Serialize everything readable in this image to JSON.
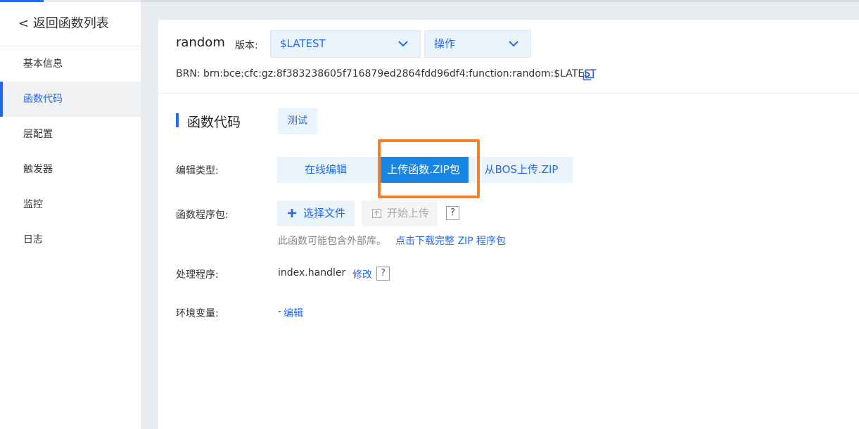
{
  "sidebar": {
    "back_label": "< 返回函数列表",
    "items": [
      {
        "label": "基本信息",
        "active": false
      },
      {
        "label": "函数代码",
        "active": true
      },
      {
        "label": "层配置",
        "active": false
      },
      {
        "label": "触发器",
        "active": false
      },
      {
        "label": "监控",
        "active": false
      },
      {
        "label": "日志",
        "active": false
      }
    ]
  },
  "header": {
    "function_name": "random",
    "version_label": "版本:",
    "version_value": "$LATEST",
    "operations_label": "操作",
    "brn": "BRN:  brn:bce:cfc:gz:8f383238605f716879ed2864fdd96df4:function:random:$LATEST"
  },
  "code_section": {
    "title": "函数代码",
    "test_button": "测试",
    "edit_type_label": "编辑类型:",
    "tabs": [
      {
        "label": "在线编辑",
        "active": false
      },
      {
        "label": "上传函数.ZIP包",
        "active": true
      },
      {
        "label": "从BOS上传.ZIP",
        "active": false
      }
    ],
    "package_label": "函数程序包:",
    "choose_file": "选择文件",
    "start_upload": "开始上传",
    "help": "?",
    "hint": "此函数可能包含外部库。",
    "download_link": "点击下载完整 ZIP 程序包",
    "handler_label": "处理程序:",
    "handler_value": "index.handler",
    "modify": "修改",
    "env_label": "环境变量:",
    "env_dash": "-",
    "env_edit": "编辑"
  },
  "colors": {
    "accent": "#2468f2",
    "active_tab": "#1a86e3",
    "highlight": "#f47f2a",
    "light_blue": "#eaf4fd"
  }
}
